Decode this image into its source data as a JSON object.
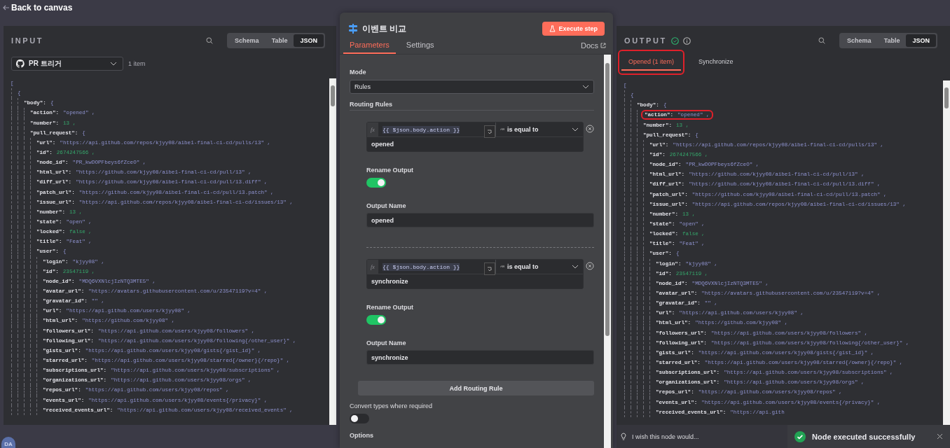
{
  "top_bar": {
    "back_link": "Back to canvas"
  },
  "input": {
    "title": "INPUT",
    "views": [
      {
        "label": "Schema",
        "selected": false
      },
      {
        "label": "Table",
        "selected": false
      },
      {
        "label": "JSON",
        "selected": true
      }
    ],
    "node_select": {
      "value": "PR 트리거"
    },
    "item_count": "1 item",
    "tree": [
      {
        "open": "[",
        "children": [
          {
            "open": "{",
            "children": [
              {
                "key": "\"body\":",
                "open": "{",
                "children": [
                  {
                    "key": "\"action\":",
                    "value": "\"opened\" ,",
                    "kind": "string"
                  },
                  {
                    "key": "\"number\":",
                    "value": "13 ,",
                    "kind": "number"
                  },
                  {
                    "key": "\"pull_request\":",
                    "open": "{",
                    "children": [
                      {
                        "key": "\"url\":",
                        "value": "\"https://api.github.com/repos/kjyy08/aibe1-final-ci-cd/pulls/13\" ,",
                        "kind": "string"
                      },
                      {
                        "key": "\"id\":",
                        "value": "2674247566 ,",
                        "kind": "number"
                      },
                      {
                        "key": "\"node_id\":",
                        "value": "\"PR_kwDOPFbeys6fZceO\" ,",
                        "kind": "string"
                      },
                      {
                        "key": "\"html_url\":",
                        "value": "\"https://github.com/kjyy08/aibe1-final-ci-cd/pull/13\" ,",
                        "kind": "string"
                      },
                      {
                        "key": "\"diff_url\":",
                        "value": "\"https://github.com/kjyy08/aibe1-final-ci-cd/pull/13.diff\" ,",
                        "kind": "string"
                      },
                      {
                        "key": "\"patch_url\":",
                        "value": "\"https://github.com/kjyy08/aibe1-final-ci-cd/pull/13.patch\" ,",
                        "kind": "string"
                      },
                      {
                        "key": "\"issue_url\":",
                        "value": "\"https://api.github.com/repos/kjyy08/aibe1-final-ci-cd/issues/13\" ,",
                        "kind": "string"
                      },
                      {
                        "key": "\"number\":",
                        "value": "13 ,",
                        "kind": "number"
                      },
                      {
                        "key": "\"state\":",
                        "value": "\"open\" ,",
                        "kind": "string"
                      },
                      {
                        "key": "\"locked\":",
                        "value": "false ,",
                        "kind": "boolean"
                      },
                      {
                        "key": "\"title\":",
                        "value": "\"Feat\" ,",
                        "kind": "string"
                      },
                      {
                        "key": "\"user\":",
                        "open": "{",
                        "children": [
                          {
                            "key": "\"login\":",
                            "value": "\"kjyy08\" ,",
                            "kind": "string"
                          },
                          {
                            "key": "\"id\":",
                            "value": "23547119 ,",
                            "kind": "number"
                          },
                          {
                            "key": "\"node_id\":",
                            "value": "\"MDQ6VXNlcjIzNTQ3MTE5\" ,",
                            "kind": "string"
                          },
                          {
                            "key": "\"avatar_url\":",
                            "value": "\"https://avatars.githubusercontent.com/u/23547119?v=4\" ,",
                            "kind": "string"
                          },
                          {
                            "key": "\"gravatar_id\":",
                            "value": "\"\" ,",
                            "kind": "string"
                          },
                          {
                            "key": "\"url\":",
                            "value": "\"https://api.github.com/users/kjyy08\" ,",
                            "kind": "string"
                          },
                          {
                            "key": "\"html_url\":",
                            "value": "\"https://github.com/kjyy08\" ,",
                            "kind": "string"
                          },
                          {
                            "key": "\"followers_url\":",
                            "value": "\"https://api.github.com/users/kjyy08/followers\" ,",
                            "kind": "string"
                          },
                          {
                            "key": "\"following_url\":",
                            "value": "\"https://api.github.com/users/kjyy08/following{/other_user}\" ,",
                            "kind": "string"
                          },
                          {
                            "key": "\"gists_url\":",
                            "value": "\"https://api.github.com/users/kjyy08/gists{/gist_id}\" ,",
                            "kind": "string"
                          },
                          {
                            "key": "\"starred_url\":",
                            "value": "\"https://api.github.com/users/kjyy08/starred{/owner}{/repo}\" ,",
                            "kind": "string"
                          },
                          {
                            "key": "\"subscriptions_url\":",
                            "value": "\"https://api.github.com/users/kjyy08/subscriptions\" ,",
                            "kind": "string"
                          },
                          {
                            "key": "\"organizations_url\":",
                            "value": "\"https://api.github.com/users/kjyy08/orgs\" ,",
                            "kind": "string"
                          },
                          {
                            "key": "\"repos_url\":",
                            "value": "\"https://api.github.com/users/kjyy08/repos\" ,",
                            "kind": "string"
                          },
                          {
                            "key": "\"events_url\":",
                            "value": "\"https://api.github.com/users/kjyy08/events{/privacy}\" ,",
                            "kind": "string"
                          },
                          {
                            "key": "\"received_events_url\":",
                            "value": "\"https://api.github.com/users/kjyy08/received_events\" ,",
                            "kind": "string"
                          }
                        ]
                      }
                    ]
                  }
                ]
              }
            ]
          }
        ]
      }
    ]
  },
  "node_panel": {
    "title": "이벤트 비교",
    "execute_button": "Execute step",
    "tabs": [
      {
        "label": "Parameters",
        "selected": true
      },
      {
        "label": "Settings",
        "selected": false
      }
    ],
    "docs_link": "Docs",
    "mode": {
      "label": "Mode",
      "value": "Rules"
    },
    "routing_rules_label": "Routing Rules",
    "rules": [
      {
        "expression_label": "fx",
        "expression": "{{ $json.body.action }}",
        "type_glyph": "ᴬᴮ",
        "operator": "is equal to",
        "value": "opened",
        "rename_label": "Rename Output",
        "rename_on": true,
        "output_name_label": "Output Name",
        "output_name": "opened"
      },
      {
        "expression_label": "fx",
        "expression": "{{ $json.body.action }}",
        "type_glyph": "ᴬᴮ",
        "operator": "is equal to",
        "value": "synchronize",
        "rename_label": "Rename Output",
        "rename_on": true,
        "output_name_label": "Output Name",
        "output_name": "synchronize"
      }
    ],
    "add_button": "Add Routing Rule",
    "convert": {
      "label": "Convert types where required",
      "on": false
    },
    "options_label": "Options"
  },
  "output": {
    "title": "OUTPUT",
    "views": [
      {
        "label": "Schema",
        "selected": false
      },
      {
        "label": "Table",
        "selected": false
      },
      {
        "label": "JSON",
        "selected": true
      }
    ],
    "branches": [
      {
        "label": "Opened (1 item)",
        "selected": true,
        "highlighted": true
      },
      {
        "label": "Synchronize",
        "selected": false
      }
    ],
    "tree": [
      {
        "open": "[",
        "children": [
          {
            "open": "{",
            "children": [
              {
                "key": "\"body\":",
                "open": "{",
                "children": [
                  {
                    "key": "\"action\":",
                    "value": "\"opened\" ,",
                    "kind": "string",
                    "highlighted": true
                  },
                  {
                    "key": "\"number\":",
                    "value": "13 ,",
                    "kind": "number"
                  },
                  {
                    "key": "\"pull_request\":",
                    "open": "{",
                    "children": [
                      {
                        "key": "\"url\":",
                        "value": "\"https://api.github.com/repos/kjyy08/aibe1-final-ci-cd/pulls/13\" ,",
                        "kind": "string"
                      },
                      {
                        "key": "\"id\":",
                        "value": "2674247566 ,",
                        "kind": "number"
                      },
                      {
                        "key": "\"node_id\":",
                        "value": "\"PR_kwDOPFbeys6fZceO\" ,",
                        "kind": "string"
                      },
                      {
                        "key": "\"html_url\":",
                        "value": "\"https://github.com/kjyy08/aibe1-final-ci-cd/pull/13\" ,",
                        "kind": "string"
                      },
                      {
                        "key": "\"diff_url\":",
                        "value": "\"https://github.com/kjyy08/aibe1-final-ci-cd/pull/13.diff\" ,",
                        "kind": "string"
                      },
                      {
                        "key": "\"patch_url\":",
                        "value": "\"https://github.com/kjyy08/aibe1-final-ci-cd/pull/13.patch\" ,",
                        "kind": "string"
                      },
                      {
                        "key": "\"issue_url\":",
                        "value": "\"https://api.github.com/repos/kjyy08/aibe1-final-ci-cd/issues/13\" ,",
                        "kind": "string"
                      },
                      {
                        "key": "\"number\":",
                        "value": "13 ,",
                        "kind": "number"
                      },
                      {
                        "key": "\"state\":",
                        "value": "\"open\" ,",
                        "kind": "string"
                      },
                      {
                        "key": "\"locked\":",
                        "value": "false ,",
                        "kind": "boolean"
                      },
                      {
                        "key": "\"title\":",
                        "value": "\"Feat\" ,",
                        "kind": "string"
                      },
                      {
                        "key": "\"user\":",
                        "open": "{",
                        "children": [
                          {
                            "key": "\"login\":",
                            "value": "\"kjyy08\" ,",
                            "kind": "string"
                          },
                          {
                            "key": "\"id\":",
                            "value": "23547119 ,",
                            "kind": "number"
                          },
                          {
                            "key": "\"node_id\":",
                            "value": "\"MDQ6VXNlcjIzNTQ3MTE5\" ,",
                            "kind": "string"
                          },
                          {
                            "key": "\"avatar_url\":",
                            "value": "\"https://avatars.githubusercontent.com/u/23547119?v=4\" ,",
                            "kind": "string"
                          },
                          {
                            "key": "\"gravatar_id\":",
                            "value": "\"\" ,",
                            "kind": "string"
                          },
                          {
                            "key": "\"url\":",
                            "value": "\"https://api.github.com/users/kjyy08\" ,",
                            "kind": "string"
                          },
                          {
                            "key": "\"html_url\":",
                            "value": "\"https://github.com/kjyy08\" ,",
                            "kind": "string"
                          },
                          {
                            "key": "\"followers_url\":",
                            "value": "\"https://api.github.com/users/kjyy08/followers\" ,",
                            "kind": "string"
                          },
                          {
                            "key": "\"following_url\":",
                            "value": "\"https://api.github.com/users/kjyy08/following{/other_user}\" ,",
                            "kind": "string"
                          },
                          {
                            "key": "\"gists_url\":",
                            "value": "\"https://api.github.com/users/kjyy08/gists{/gist_id}\" ,",
                            "kind": "string"
                          },
                          {
                            "key": "\"starred_url\":",
                            "value": "\"https://api.github.com/users/kjyy08/starred{/owner}{/repo}\" ,",
                            "kind": "string"
                          },
                          {
                            "key": "\"subscriptions_url\":",
                            "value": "\"https://api.github.com/users/kjyy08/subscriptions\" ,",
                            "kind": "string"
                          },
                          {
                            "key": "\"organizations_url\":",
                            "value": "\"https://api.github.com/users/kjyy08/orgs\" ,",
                            "kind": "string"
                          },
                          {
                            "key": "\"repos_url\":",
                            "value": "\"https://api.github.com/users/kjyy08/repos\" ,",
                            "kind": "string"
                          },
                          {
                            "key": "\"events_url\":",
                            "value": "\"https://api.github.com/users/kjyy08/events{/privacy}\" ,",
                            "kind": "string"
                          },
                          {
                            "key": "\"received_events_url\":",
                            "value": "\"https://api.gith",
                            "kind": "string"
                          }
                        ]
                      }
                    ]
                  }
                ]
              }
            ]
          }
        ]
      }
    ]
  },
  "avatar": "DA",
  "feedback": "I wish this node would...",
  "toast": {
    "message": "Node executed successfully"
  }
}
